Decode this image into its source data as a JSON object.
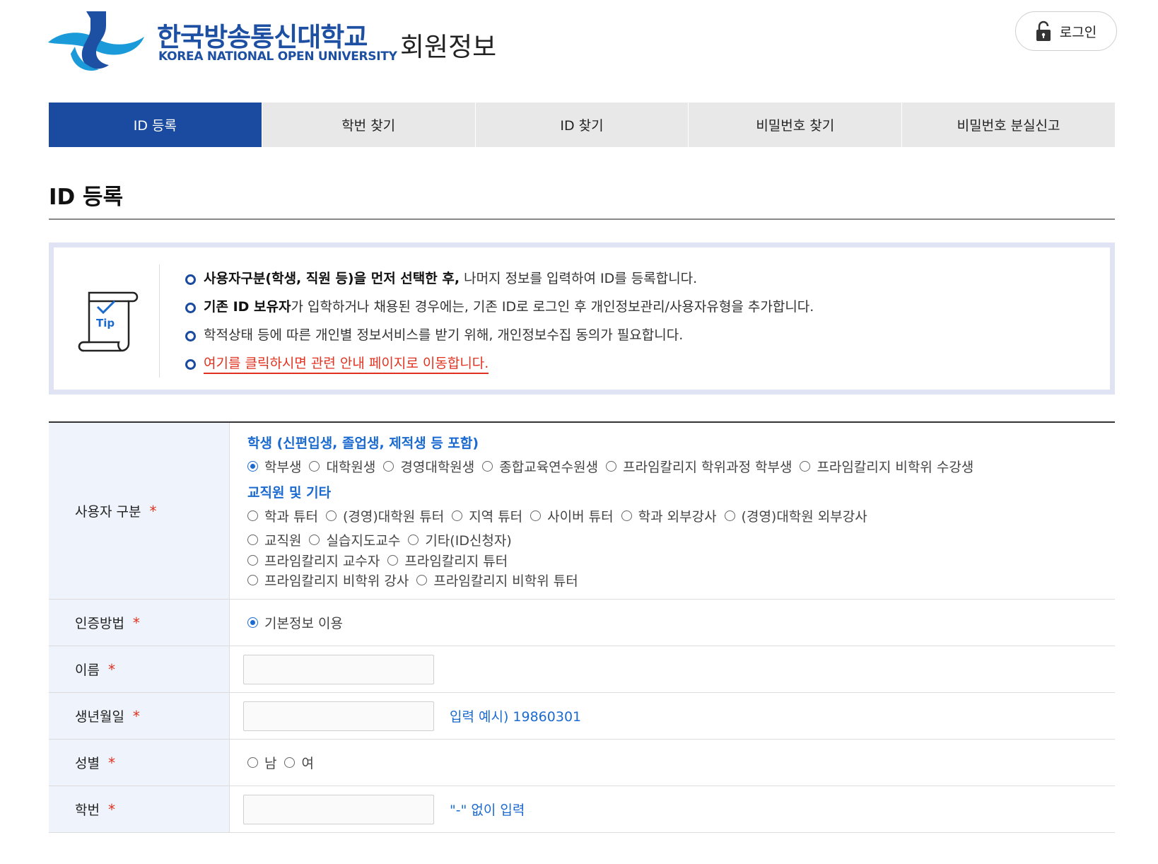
{
  "header": {
    "logo_kr": "한국방송통신대학교",
    "logo_en": "KOREA NATIONAL OPEN UNIVERSITY",
    "page_heading": "회원정보",
    "login_label": "로그인",
    "brand_color": "#1d4fa3"
  },
  "tabs": [
    {
      "label": "ID 등록",
      "active": true
    },
    {
      "label": "학번 찾기",
      "active": false
    },
    {
      "label": "ID 찾기",
      "active": false
    },
    {
      "label": "비밀번호 찾기",
      "active": false
    },
    {
      "label": "비밀번호 분실신고",
      "active": false
    }
  ],
  "section_title": "ID 등록",
  "tip": {
    "icon_label": "Tip",
    "items": [
      {
        "bold": "사용자구분(학생, 직원 등)을 먼저 선택한 후,",
        "text": " 나머지 정보를 입력하여 ID를 등록합니다."
      },
      {
        "bold": "기존 ID 보유자",
        "text": "가 입학하거나 채용된 경우에는, 기존 ID로 로그인 후 개인정보관리/사용자유형을 추가합니다."
      },
      {
        "bold": "",
        "text": "학적상태 등에 따른 개인별 정보서비스를 받기 위해, 개인정보수집 동의가 필요합니다."
      },
      {
        "link": "여기를 클릭하시면 관련 안내 페이지로 이동합니다."
      }
    ]
  },
  "form": {
    "user_type": {
      "label": "사용자 구분",
      "required_mark": "*",
      "group_student": "학생 (신편입생, 졸업생, 제적생 등 포함)",
      "student_options": [
        "학부생",
        "대학원생",
        "경영대학원생",
        "종합교육연수원생",
        "프라임칼리지 학위과정 학부생",
        "프라임칼리지 비학위 수강생"
      ],
      "group_staff": "교직원 및 기타",
      "staff_lines": [
        [
          "학과 튜터",
          "(경영)대학원 튜터",
          "지역 튜터",
          "사이버 튜터",
          "학과 외부강사",
          "(경영)대학원 외부강사"
        ],
        [
          "교직원",
          "실습지도교수",
          "기타(ID신청자)"
        ],
        [
          "프라임칼리지 교수자",
          "프라임칼리지 튜터"
        ],
        [
          "프라임칼리지 비학위 강사",
          "프라임칼리지 비학위 튜터"
        ]
      ],
      "selected": "학부생"
    },
    "auth_method": {
      "label": "인증방법",
      "required_mark": "*",
      "option": "기본정보 이용"
    },
    "name": {
      "label": "이름",
      "required_mark": "*",
      "value": ""
    },
    "birth": {
      "label": "생년월일",
      "required_mark": "*",
      "value": "",
      "hint": "입력 예시) 19860301"
    },
    "gender": {
      "label": "성별",
      "required_mark": "*",
      "options": [
        "남",
        "여"
      ]
    },
    "student_no": {
      "label": "학번",
      "required_mark": "*",
      "value": "",
      "hint": "\"-\" 없이 입력"
    }
  }
}
